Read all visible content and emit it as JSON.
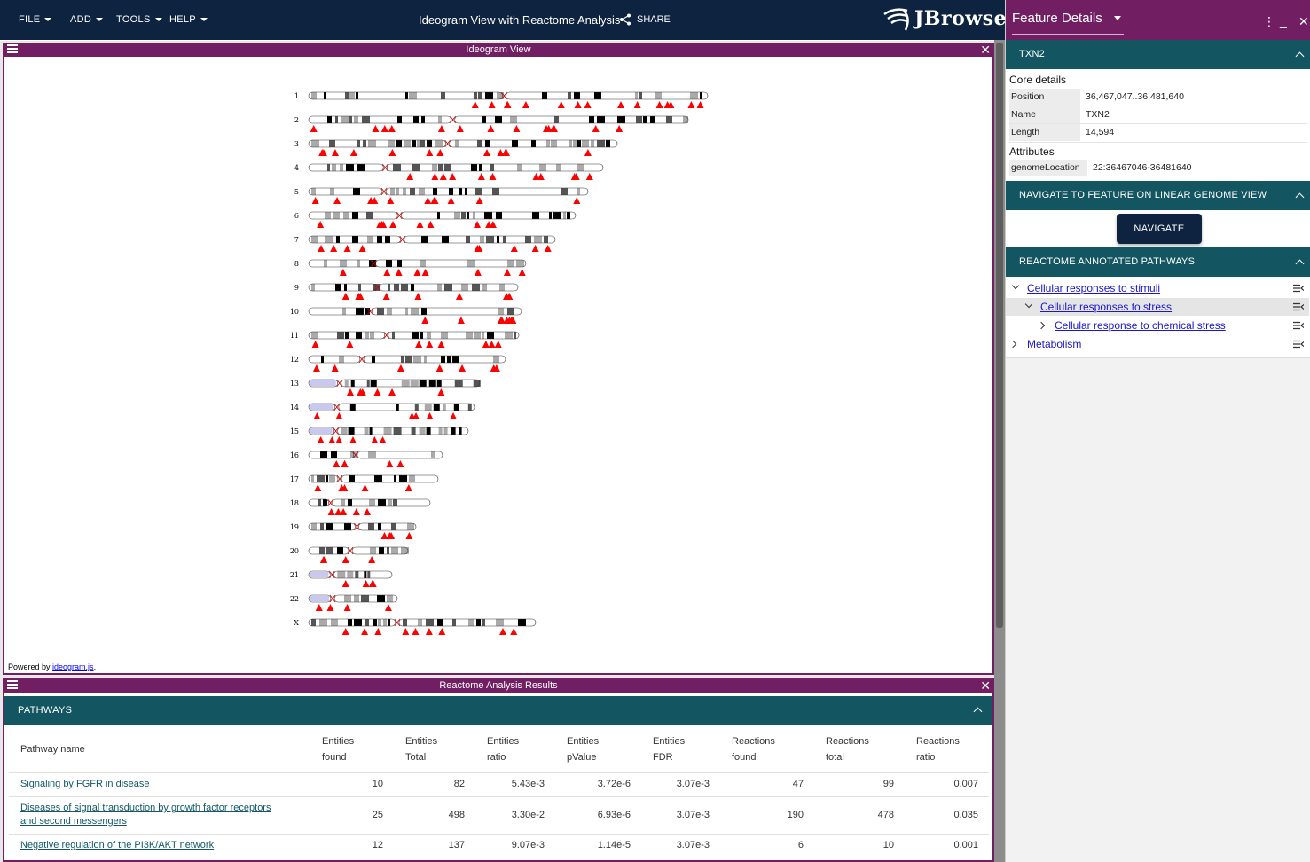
{
  "topbar": {
    "menus": [
      {
        "label": "FILE"
      },
      {
        "label": "ADD"
      },
      {
        "label": "TOOLS"
      },
      {
        "label": "HELP"
      }
    ],
    "session_title": "Ideogram View with Reactome Analysis",
    "share_label": "SHARE",
    "logo_text": "JBrowse"
  },
  "ideogram_view": {
    "title": "Ideogram View",
    "powered_prefix": "Powered by ",
    "powered_link": "ideogram.js",
    "powered_suffix": ".",
    "chromosomes": [
      "1",
      "2",
      "3",
      "4",
      "5",
      "6",
      "7",
      "8",
      "9",
      "10",
      "11",
      "12",
      "13",
      "14",
      "15",
      "16",
      "17",
      "18",
      "19",
      "20",
      "21",
      "22",
      "X"
    ]
  },
  "reactome_view": {
    "title": "Reactome Analysis Results",
    "section_title": "PATHWAYS",
    "columns": [
      {
        "line1": "Pathway name",
        "line2": ""
      },
      {
        "line1": "Entities",
        "line2": "found"
      },
      {
        "line1": "Entities",
        "line2": "Total"
      },
      {
        "line1": "Entities",
        "line2": "ratio"
      },
      {
        "line1": "Entities",
        "line2": "pValue"
      },
      {
        "line1": "Entities",
        "line2": "FDR"
      },
      {
        "line1": "Reactions",
        "line2": "found"
      },
      {
        "line1": "Reactions",
        "line2": "total"
      },
      {
        "line1": "Reactions",
        "line2": "ratio"
      }
    ],
    "rows": [
      {
        "name_line1": "Signaling by FGFR in disease",
        "name_line2": "",
        "entities_found": "10",
        "entities_total": "82",
        "entities_ratio": "5.43e-3",
        "entities_pvalue": "3.72e-6",
        "entities_fdr": "3.07e-3",
        "reactions_found": "47",
        "reactions_total": "99",
        "reactions_ratio": "0.007"
      },
      {
        "name_line1": "Diseases of signal transduction by growth factor receptors",
        "name_line2": "and second messengers",
        "entities_found": "25",
        "entities_total": "498",
        "entities_ratio": "3.30e-2",
        "entities_pvalue": "6.93e-6",
        "entities_fdr": "3.07e-3",
        "reactions_found": "190",
        "reactions_total": "478",
        "reactions_ratio": "0.035"
      },
      {
        "name_line1": "Negative regulation of the PI3K/AKT network",
        "name_line2": "",
        "entities_found": "12",
        "entities_total": "137",
        "entities_ratio": "9.07e-3",
        "entities_pvalue": "1.14e-5",
        "entities_fdr": "3.07e-3",
        "reactions_found": "6",
        "reactions_total": "10",
        "reactions_ratio": "0.001"
      }
    ]
  },
  "feature_details": {
    "title": "Feature Details",
    "feature_name": "TXN2",
    "core_label": "Core details",
    "core": [
      {
        "key": "Position",
        "value": "36,467,047..36,481,640"
      },
      {
        "key": "Name",
        "value": "TXN2"
      },
      {
        "key": "Length",
        "value": "14,594"
      }
    ],
    "attributes_label": "Attributes",
    "attributes": [
      {
        "key": "genomeLocation",
        "value": "22:36467046-36481640"
      }
    ],
    "navigate_section": "NAVIGATE TO FEATURE ON LINEAR GENOME VIEW",
    "navigate_button": "NAVIGATE",
    "pathways_section": "REACTOME ANNOTATED PATHWAYS",
    "pathway_tree": [
      {
        "label": "Cellular responses to stimuli",
        "expanded": true,
        "selected": false
      },
      {
        "label": "Cellular responses to stress",
        "expanded": true,
        "selected": true
      },
      {
        "label": "Cellular response to chemical stress",
        "expanded": false,
        "selected": false
      },
      {
        "label": "Metabolism",
        "expanded": false,
        "selected": false
      }
    ]
  },
  "colors": {
    "app_bar": "#0d233f",
    "view_header": "#721e63",
    "accordion": "#135560",
    "annotation": "#ff0000",
    "centromere": "#cc0000",
    "acrocentric_arm": "#c8c8f0",
    "link": "#1a16d0"
  }
}
